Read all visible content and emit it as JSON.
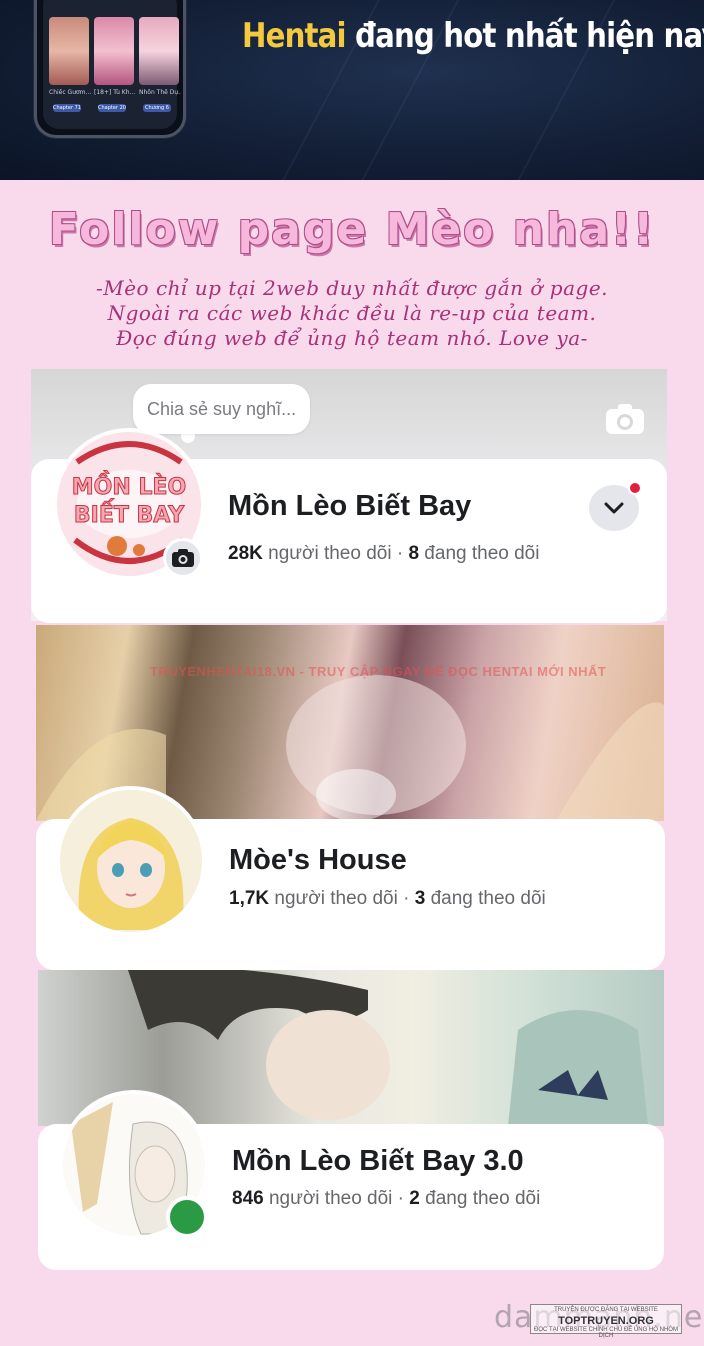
{
  "banner": {
    "title_highlight": "Hentai",
    "title_rest": " đang hot nhất hiện nay.",
    "phone": {
      "captions": [
        "Chiếc Gươm...",
        "[18+] Tù Kh...",
        "Nhốn Thế Dụ..."
      ],
      "badges": [
        "Chapter 71",
        "Chapter 20",
        "Chương 6"
      ]
    }
  },
  "notice": {
    "title": "Follow page Mèo nha!!",
    "lines": [
      "-Mèo chỉ up tại 2web duy nhất được gắn ở page.",
      "Ngoài ra các web khác đều là re-up của team.",
      "Đọc đúng web để ủng hộ team nhó. Love ya-"
    ]
  },
  "composer": {
    "placeholder": "Chia sẻ suy nghĩ..."
  },
  "pages": [
    {
      "name": "Mồn Lèo Biết Bay",
      "followers": "28K",
      "followers_label": " người theo dõi · ",
      "following": "8",
      "following_label": " đang theo dõi"
    },
    {
      "name": "Mòe's House",
      "followers": "1,7K",
      "followers_label": " người theo dõi · ",
      "following": "3",
      "following_label": " đang theo dõi"
    },
    {
      "name": "Mồn Lèo Biết Bay 3.0",
      "followers": "846",
      "followers_label": " người theo dõi · ",
      "following": "2",
      "following_label": " đang theo dõi"
    }
  ],
  "avatar_logo_text": "MỒN LÈO BIẾT BAY",
  "watermarks": {
    "cover": "TRUYENHENTAI18.VN - TRUY CẬP NGAY ĐỂ ĐỌC HENTAI MỚI NHẤT",
    "footer": "dammanh.net",
    "footer_box": [
      "TRUYỆN ĐƯỢC ĐĂNG TẠI WEBSITE",
      "TOPTRUYEN.ORG",
      "ĐỌC TẠI WEBSITE CHÍNH CHỦ ĐỂ ỦNG HỘ NHÓM DỊCH"
    ]
  },
  "colors": {
    "page_bg": "#f9d9ec",
    "banner_bg": "#131f36",
    "highlight": "#f4c93e",
    "notice_text": "#a6327a",
    "online": "#2a9a45",
    "notification": "#e41e3f"
  }
}
